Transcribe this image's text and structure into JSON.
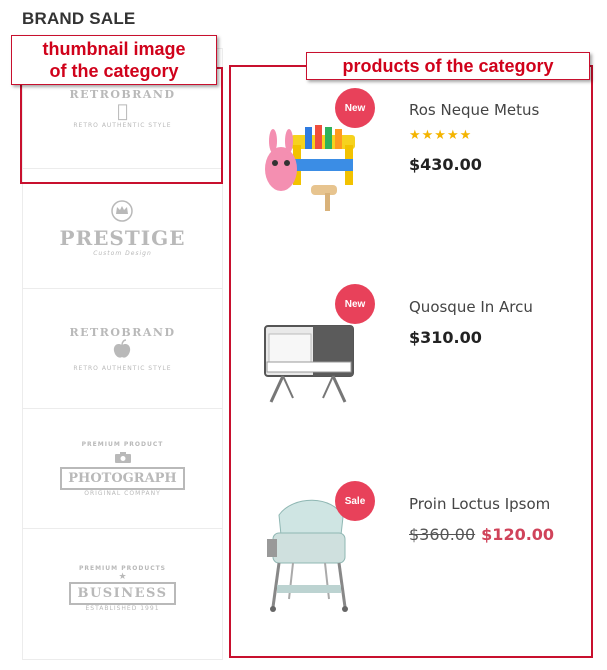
{
  "section_title": "BRAND SALE",
  "annotations": {
    "thumbnail_label": "thumbnail image of the category",
    "thumbnail_line1": "thumbnail image",
    "thumbnail_line2": "of the category",
    "products_label": "products of the category"
  },
  "brands": [
    {
      "arc": "RETROBRAND",
      "small": "RETRO AUTHENTIC STYLE",
      "icon": "apple-icon"
    },
    {
      "arc": "",
      "big": "PRESTIGE",
      "small": "Custom Design",
      "icon": "crown-icon"
    },
    {
      "arc": "RETROBRAND",
      "small": "RETRO AUTHENTIC STYLE",
      "icon": "apple-icon"
    },
    {
      "arc": "PREMIUM PRODUCT",
      "big": "PHOTOGRAPH",
      "small": "ORIGINAL COMPANY",
      "icon": "camera-icon"
    },
    {
      "arc": "PREMIUM PRODUCTS",
      "big": "BUSINESS",
      "small": "ESTABLISHED 1991",
      "icon": "star-icon"
    }
  ],
  "products": [
    {
      "name": "Ros Neque Metus",
      "badge": "New",
      "stars": "★★★★★",
      "price": "$430.00",
      "image": "toy-hammer-bench-icon",
      "rating": 5
    },
    {
      "name": "Quosque In Arcu",
      "badge": "New",
      "price": "$310.00",
      "image": "bedside-crib-icon"
    },
    {
      "name": "Proin Loctus Ipsom",
      "badge": "Sale",
      "old_price": "$360.00",
      "sale_price": "$120.00",
      "image": "bassinet-icon"
    }
  ],
  "colors": {
    "accent": "#c8102e",
    "badge": "#e8415a",
    "sale": "#d0435a",
    "star": "#f4b400"
  }
}
